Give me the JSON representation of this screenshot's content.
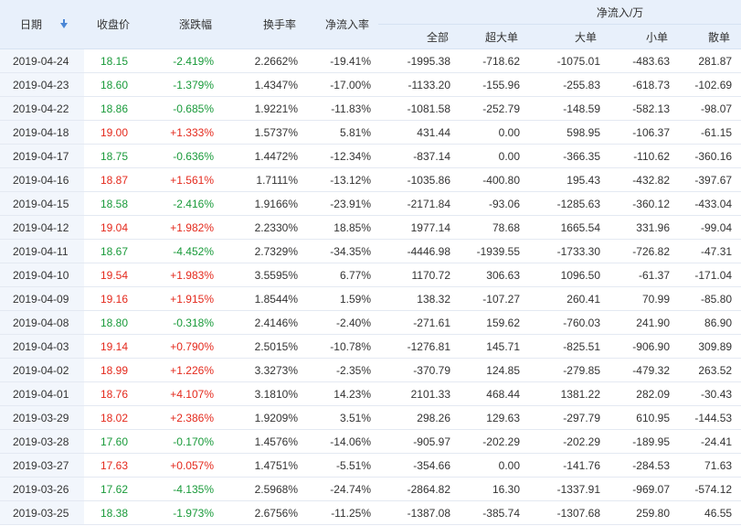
{
  "header": {
    "date": "日期",
    "close": "收盘价",
    "change": "涨跌幅",
    "turnover": "换手率",
    "net_rate": "净流入率",
    "net_group": "净流入/万",
    "total": "全部",
    "super_large": "超大单",
    "large": "大单",
    "small": "小单",
    "retail": "散单"
  },
  "rows": [
    {
      "date": "2019-04-24",
      "close": "18.15",
      "change": "-2.419%",
      "turnover": "2.2662%",
      "rate": "-19.41%",
      "total": "-1995.38",
      "super": "-718.62",
      "large": "-1075.01",
      "small": "-483.63",
      "retail": "281.87",
      "dir": "down"
    },
    {
      "date": "2019-04-23",
      "close": "18.60",
      "change": "-1.379%",
      "turnover": "1.4347%",
      "rate": "-17.00%",
      "total": "-1133.20",
      "super": "-155.96",
      "large": "-255.83",
      "small": "-618.73",
      "retail": "-102.69",
      "dir": "down"
    },
    {
      "date": "2019-04-22",
      "close": "18.86",
      "change": "-0.685%",
      "turnover": "1.9221%",
      "rate": "-11.83%",
      "total": "-1081.58",
      "super": "-252.79",
      "large": "-148.59",
      "small": "-582.13",
      "retail": "-98.07",
      "dir": "down"
    },
    {
      "date": "2019-04-18",
      "close": "19.00",
      "change": "+1.333%",
      "turnover": "1.5737%",
      "rate": "5.81%",
      "total": "431.44",
      "super": "0.00",
      "large": "598.95",
      "small": "-106.37",
      "retail": "-61.15",
      "dir": "up"
    },
    {
      "date": "2019-04-17",
      "close": "18.75",
      "change": "-0.636%",
      "turnover": "1.4472%",
      "rate": "-12.34%",
      "total": "-837.14",
      "super": "0.00",
      "large": "-366.35",
      "small": "-110.62",
      "retail": "-360.16",
      "dir": "down"
    },
    {
      "date": "2019-04-16",
      "close": "18.87",
      "change": "+1.561%",
      "turnover": "1.7111%",
      "rate": "-13.12%",
      "total": "-1035.86",
      "super": "-400.80",
      "large": "195.43",
      "small": "-432.82",
      "retail": "-397.67",
      "dir": "up"
    },
    {
      "date": "2019-04-15",
      "close": "18.58",
      "change": "-2.416%",
      "turnover": "1.9166%",
      "rate": "-23.91%",
      "total": "-2171.84",
      "super": "-93.06",
      "large": "-1285.63",
      "small": "-360.12",
      "retail": "-433.04",
      "dir": "down"
    },
    {
      "date": "2019-04-12",
      "close": "19.04",
      "change": "+1.982%",
      "turnover": "2.2330%",
      "rate": "18.85%",
      "total": "1977.14",
      "super": "78.68",
      "large": "1665.54",
      "small": "331.96",
      "retail": "-99.04",
      "dir": "up"
    },
    {
      "date": "2019-04-11",
      "close": "18.67",
      "change": "-4.452%",
      "turnover": "2.7329%",
      "rate": "-34.35%",
      "total": "-4446.98",
      "super": "-1939.55",
      "large": "-1733.30",
      "small": "-726.82",
      "retail": "-47.31",
      "dir": "down"
    },
    {
      "date": "2019-04-10",
      "close": "19.54",
      "change": "+1.983%",
      "turnover": "3.5595%",
      "rate": "6.77%",
      "total": "1170.72",
      "super": "306.63",
      "large": "1096.50",
      "small": "-61.37",
      "retail": "-171.04",
      "dir": "up"
    },
    {
      "date": "2019-04-09",
      "close": "19.16",
      "change": "+1.915%",
      "turnover": "1.8544%",
      "rate": "1.59%",
      "total": "138.32",
      "super": "-107.27",
      "large": "260.41",
      "small": "70.99",
      "retail": "-85.80",
      "dir": "up"
    },
    {
      "date": "2019-04-08",
      "close": "18.80",
      "change": "-0.318%",
      "turnover": "2.4146%",
      "rate": "-2.40%",
      "total": "-271.61",
      "super": "159.62",
      "large": "-760.03",
      "small": "241.90",
      "retail": "86.90",
      "dir": "down"
    },
    {
      "date": "2019-04-03",
      "close": "19.14",
      "change": "+0.790%",
      "turnover": "2.5015%",
      "rate": "-10.78%",
      "total": "-1276.81",
      "super": "145.71",
      "large": "-825.51",
      "small": "-906.90",
      "retail": "309.89",
      "dir": "up"
    },
    {
      "date": "2019-04-02",
      "close": "18.99",
      "change": "+1.226%",
      "turnover": "3.3273%",
      "rate": "-2.35%",
      "total": "-370.79",
      "super": "124.85",
      "large": "-279.85",
      "small": "-479.32",
      "retail": "263.52",
      "dir": "up"
    },
    {
      "date": "2019-04-01",
      "close": "18.76",
      "change": "+4.107%",
      "turnover": "3.1810%",
      "rate": "14.23%",
      "total": "2101.33",
      "super": "468.44",
      "large": "1381.22",
      "small": "282.09",
      "retail": "-30.43",
      "dir": "up"
    },
    {
      "date": "2019-03-29",
      "close": "18.02",
      "change": "+2.386%",
      "turnover": "1.9209%",
      "rate": "3.51%",
      "total": "298.26",
      "super": "129.63",
      "large": "-297.79",
      "small": "610.95",
      "retail": "-144.53",
      "dir": "up"
    },
    {
      "date": "2019-03-28",
      "close": "17.60",
      "change": "-0.170%",
      "turnover": "1.4576%",
      "rate": "-14.06%",
      "total": "-905.97",
      "super": "-202.29",
      "large": "-189.95",
      "small": "-24.41",
      "retail": "",
      "dir": "down"
    },
    {
      "date": "2019-03-27",
      "close": "17.63",
      "change": "+0.057%",
      "turnover": "1.4751%",
      "rate": "-5.51%",
      "total": "-354.66",
      "super": "0.00",
      "large": "-141.76",
      "small": "-284.53",
      "retail": "71.63",
      "dir": "up"
    },
    {
      "date": "2019-03-26",
      "close": "17.62",
      "change": "-4.135%",
      "turnover": "2.5968%",
      "rate": "-24.74%",
      "total": "-2864.82",
      "super": "16.30",
      "large": "-1337.91",
      "small": "-969.07",
      "retail": "-574.12",
      "dir": "down"
    },
    {
      "date": "2019-03-25",
      "close": "18.38",
      "change": "-1.973%",
      "turnover": "2.6756%",
      "rate": "-11.25%",
      "total": "-1387.08",
      "super": "-385.74",
      "large": "-1307.68",
      "small": "259.80",
      "retail": "46.55",
      "dir": "down"
    }
  ]
}
